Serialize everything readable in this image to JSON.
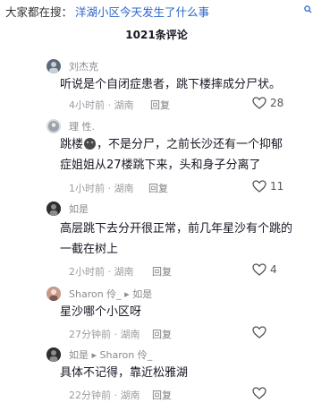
{
  "search": {
    "prefix": "大家都在搜：",
    "query": "洋湖小区今天发生了什么事"
  },
  "header": {
    "title": "1021条评论"
  },
  "comments": [
    {
      "username": "刘杰克",
      "lines": [
        "听说是个自闭症患者，跳下楼摔成分尸状。"
      ],
      "time": "4小时前 · 湖南",
      "reply": "回复",
      "likes": "28"
    },
    {
      "username": "理 性.",
      "line1_before": "跳楼",
      "line1_after": "，不是分尸，之前长沙还有一个抑郁",
      "lines": [
        "症姐姐从27楼跳下来，头和身子分离了"
      ],
      "time": "1小时前 · 湖南",
      "reply": "回复",
      "likes": "11"
    },
    {
      "username": "如是",
      "lines": [
        "高层跳下去分开很正常，前几年星沙有个跳的",
        "一截在树上"
      ],
      "time": "2小时前 · 湖南",
      "reply": "回复",
      "likes": "4"
    },
    {
      "username": "Sharon 伶_ ▸ 如是",
      "lines": [
        "星沙哪个小区呀"
      ],
      "time": "27分钟前 · 湖南",
      "reply": "回复",
      "likes": ""
    },
    {
      "username": "如是 ▸ Sharon 伶_",
      "lines": [
        "具体不记得，靠近松雅湖"
      ],
      "time": "22分钟前 · 湖南",
      "reply": "回复",
      "likes": ""
    }
  ],
  "icons": {
    "search": "search-icon",
    "like": "heart-icon",
    "emoji": "emoji-icon"
  },
  "colors": {
    "query": "#2b66c9",
    "meta": "#9a9ba1",
    "text": "#161823"
  }
}
